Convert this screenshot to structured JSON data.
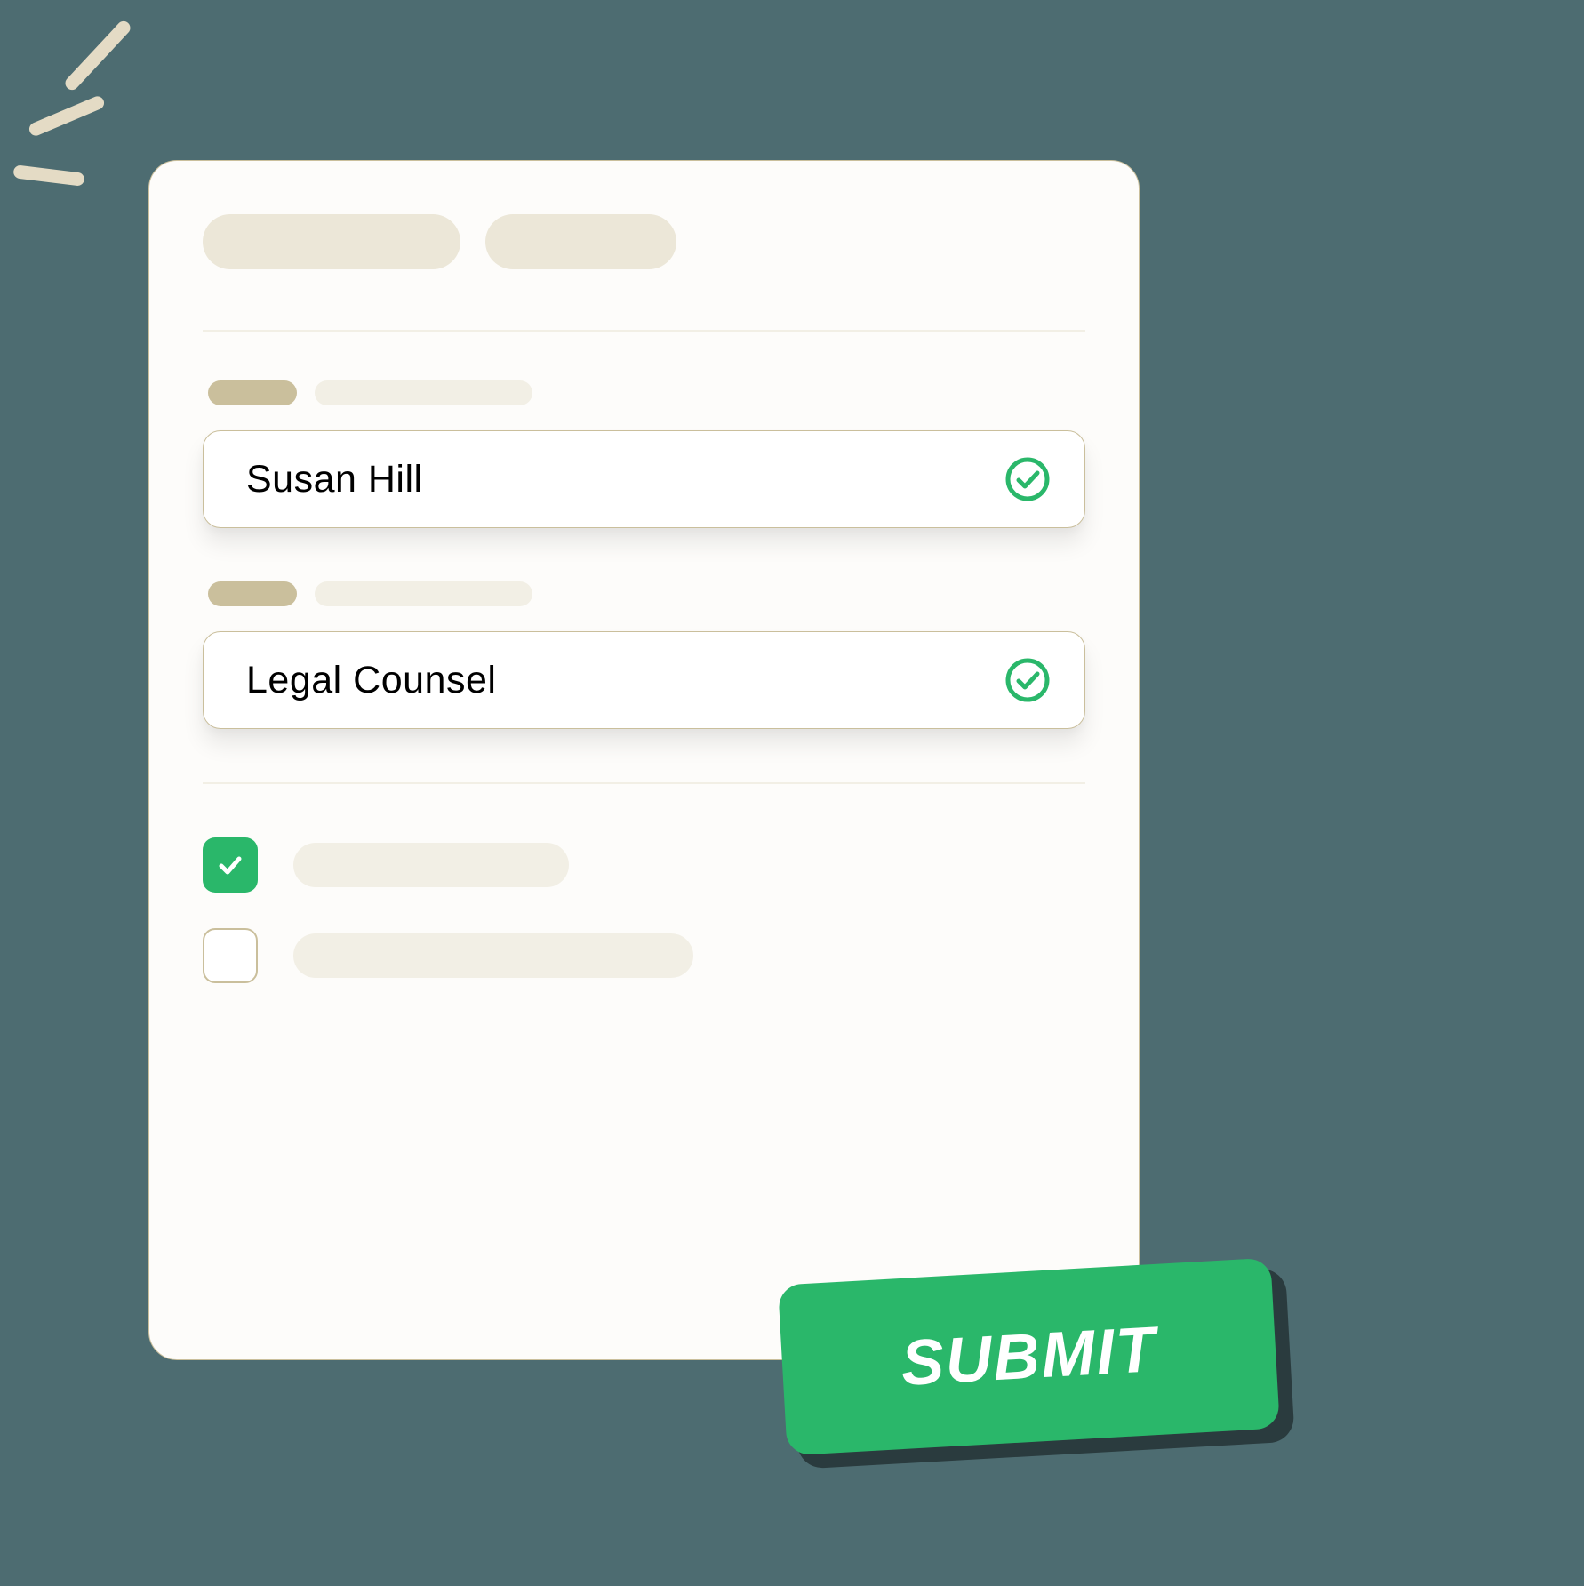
{
  "form": {
    "fields": {
      "name": {
        "value": "Susan Hill",
        "validated": true
      },
      "role": {
        "value": "Legal Counsel",
        "validated": true
      }
    },
    "checkboxes": [
      {
        "checked": true
      },
      {
        "checked": false
      }
    ]
  },
  "submit_button": {
    "label": "SUBMIT"
  },
  "colors": {
    "accent_green": "#2ab76a",
    "background": "#4d6c71",
    "card": "#fdfcfa",
    "border": "#cabf9c",
    "placeholder": "#ece7d8",
    "placeholder_light": "#f2efe5"
  }
}
